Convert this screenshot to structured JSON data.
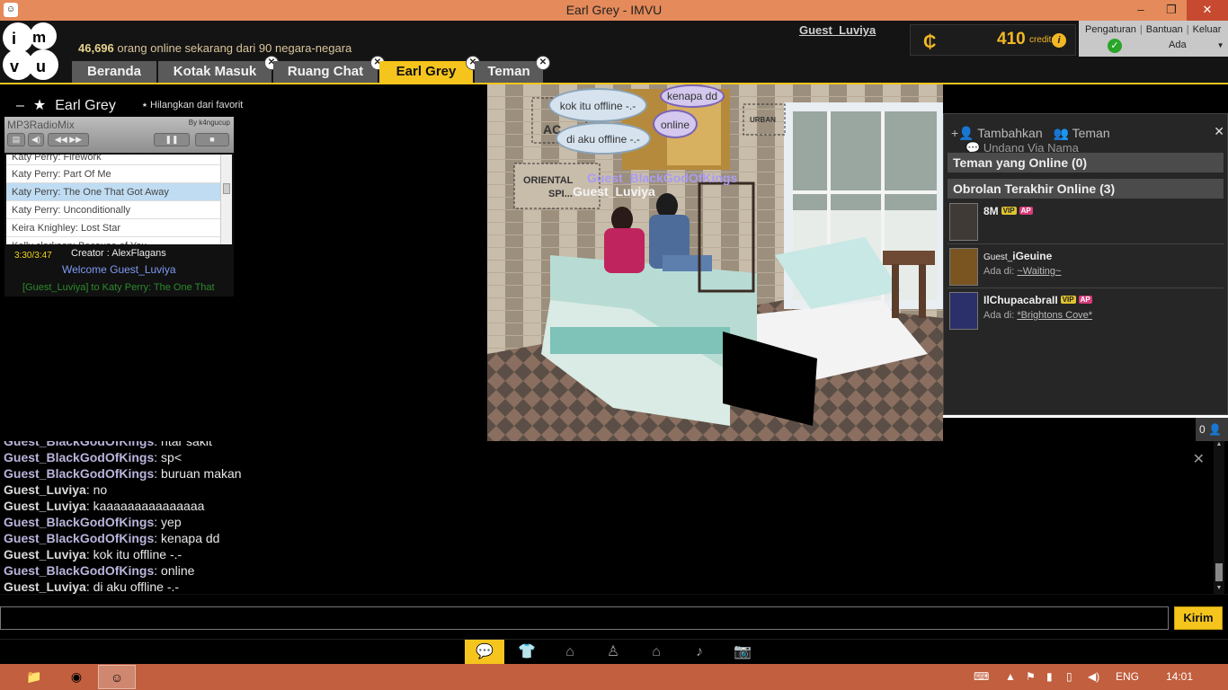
{
  "window": {
    "title": "Earl Grey  - IMVU",
    "app_icon": "imvu-icon",
    "minimize": "–",
    "maximize": "❐",
    "close": "✕"
  },
  "header": {
    "online_count": "46,696",
    "online_rest": " orang online sekarang dari 90 negara-negara",
    "username": "Guest_Luviya",
    "credits_amount": "410",
    "credits_label": "credits",
    "credits_info": "i",
    "links": [
      "Pengaturan",
      "Bantuan",
      "Keluar"
    ],
    "status_value": "Ada"
  },
  "tabs": [
    {
      "label": "Beranda",
      "closable": false
    },
    {
      "label": "Kotak Masuk",
      "closable": true
    },
    {
      "label": "Ruang Chat",
      "closable": true
    },
    {
      "label": "Earl Grey",
      "closable": true,
      "active": true
    },
    {
      "label": "Teman",
      "closable": true
    }
  ],
  "room": {
    "title": "Earl Grey",
    "fav_link": "Hilangkan dari favorit"
  },
  "mp3": {
    "name": "MP3RadioMix",
    "by": "By k4ngucup",
    "songs": [
      "Katy Perry: Firework",
      "Katy Perry: Part Of Me",
      "Katy Perry: The One That Got Away",
      "Katy Perry: Unconditionally",
      "Keira Knighley: Lost Star",
      "Kelly clarkson: Because of You"
    ],
    "selected_index": 2,
    "time": "3:30/3:47",
    "creator": "Creator : AlexFlagans",
    "welcome": "Welcome Guest_Luviya",
    "message": "[Guest_Luviya] to Katy Perry: The One That"
  },
  "scene": {
    "bubbles": [
      "kok itu offline -.-",
      "di aku offline -.-",
      "kenapa dd",
      "online"
    ],
    "avatar_names": [
      "Guest_BlackGodOfKings",
      "Guest_Luviya"
    ]
  },
  "friends": {
    "add": "Tambahkan",
    "friends_label": "Teman",
    "invite": "Undang Via Nama",
    "online_header": "Teman yang Online (0)",
    "recent_header": "Obrolan Terakhir Online (3)",
    "location_prefix": "Ada di:",
    "list": [
      {
        "name": "8M",
        "vip": true,
        "ap": true,
        "location": ""
      },
      {
        "name_prefix": "Guest_",
        "name": "iGeuine",
        "vip": false,
        "ap": false,
        "location": "~Waiting~"
      },
      {
        "name": "IlChupacabraII",
        "vip": true,
        "ap": true,
        "location": "*Brightons Cove*"
      }
    ],
    "badge_vip": "VIP",
    "badge_ap": "AP",
    "participant_count": "0"
  },
  "chat": {
    "lines": [
      {
        "who": "Guest_BlackGodOfKings",
        "text": "ntar sakit",
        "me": false
      },
      {
        "who": "Guest_BlackGodOfKings",
        "text": "sp<",
        "me": false
      },
      {
        "who": "Guest_BlackGodOfKings",
        "text": "buruan makan",
        "me": false
      },
      {
        "who": "Guest_Luviya",
        "text": "no",
        "me": true
      },
      {
        "who": "Guest_Luviya",
        "text": "kaaaaaaaaaaaaaaa",
        "me": true
      },
      {
        "who": "Guest_BlackGodOfKings",
        "text": "yep",
        "me": false
      },
      {
        "who": "Guest_BlackGodOfKings",
        "text": "kenapa dd",
        "me": false
      },
      {
        "who": "Guest_Luviya",
        "text": "kok itu offline -.-",
        "me": true
      },
      {
        "who": "Guest_BlackGodOfKings",
        "text": "online",
        "me": false
      },
      {
        "who": "Guest_Luviya",
        "text": "di aku offline -.-",
        "me": true
      }
    ],
    "input_value": "",
    "send_label": "Kirim"
  },
  "toolbar": [
    "chat-bubble-icon",
    "shirt-icon",
    "hanger-icon",
    "pose-icon",
    "house-icon",
    "music-note-icon",
    "camera-icon"
  ],
  "taskbar": {
    "lang": "ENG",
    "time": "14:01"
  }
}
